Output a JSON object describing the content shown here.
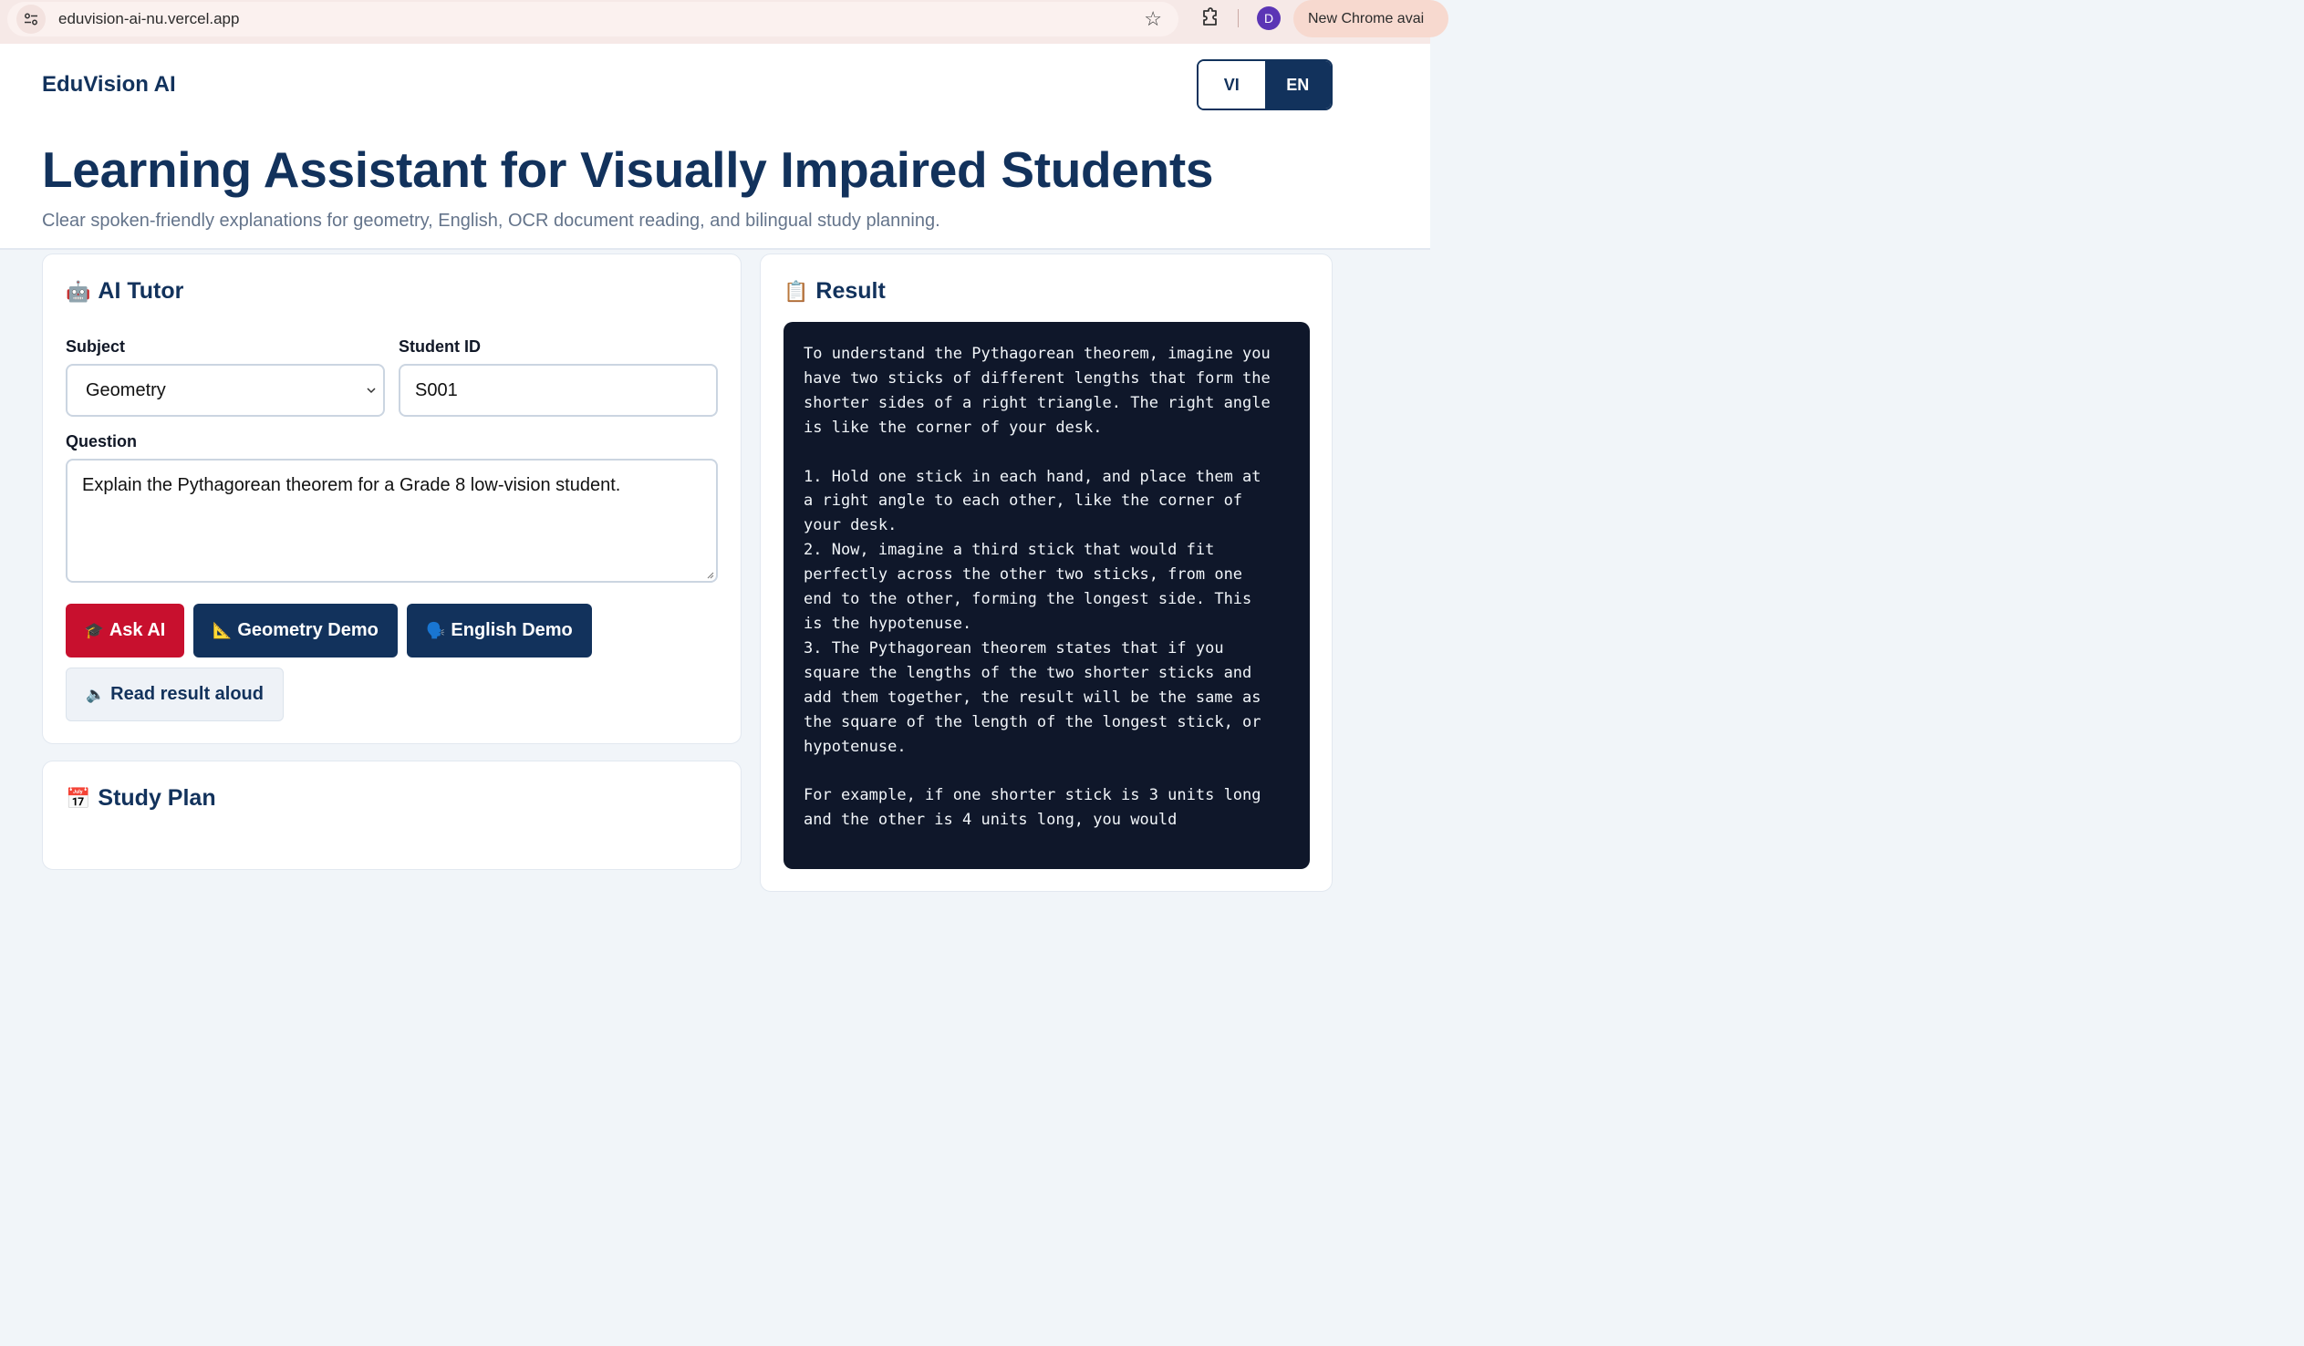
{
  "browser": {
    "url": "eduvision-ai-nu.vercel.app",
    "profile_initial": "D",
    "update_label": "New Chrome avai"
  },
  "header": {
    "brand": "EduVision AI",
    "lang_vi": "VI",
    "lang_en": "EN",
    "active_lang": "EN",
    "title": "Learning Assistant for Visually Impaired Students",
    "subtitle": "Clear spoken-friendly explanations for geometry, English, OCR document reading, and bilingual study planning."
  },
  "tutor": {
    "icon": "🤖",
    "title": "AI Tutor",
    "subject_label": "Subject",
    "subject_value": "Geometry",
    "student_id_label": "Student ID",
    "student_id_value": "S001",
    "question_label": "Question",
    "question_value": "Explain the Pythagorean theorem for a Grade 8 low-vision student.",
    "buttons": {
      "ask_icon": "🎓",
      "ask": "Ask AI",
      "geometry_icon": "📐",
      "geometry": "Geometry Demo",
      "english_icon": "🗣️",
      "english": "English Demo",
      "read_icon": "🔈",
      "read": "Read result aloud"
    }
  },
  "study_plan": {
    "icon": "📅",
    "title": "Study Plan"
  },
  "result": {
    "icon": "📋",
    "title": "Result",
    "text": "To understand the Pythagorean theorem, imagine you\nhave two sticks of different lengths that form the\nshorter sides of a right triangle. The right angle\nis like the corner of your desk.\n\n1. Hold one stick in each hand, and place them at\na right angle to each other, like the corner of\nyour desk.\n2. Now, imagine a third stick that would fit\nperfectly across the other two sticks, from one\nend to the other, forming the longest side. This\nis the hypotenuse.\n3. The Pythagorean theorem states that if you\nsquare the lengths of the two shorter sticks and\nadd them together, the result will be the same as\nthe square of the length of the longest stick, or\nhypotenuse.\n\nFor example, if one shorter stick is 3 units long\nand the other is 4 units long, you would"
  },
  "colors": {
    "navy": "#12325c",
    "red": "#c8102e",
    "result_bg": "#0f172a"
  }
}
